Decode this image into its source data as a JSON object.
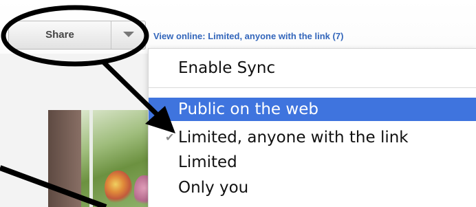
{
  "toolbar": {
    "share_label": "Share",
    "dropdown_icon": "triangle-down-icon",
    "view_online": "View online: Limited, anyone with the link (7)"
  },
  "menu": {
    "items": [
      {
        "label": "Enable Sync",
        "checked": false,
        "highlighted": false
      },
      {
        "label": "Public on the web",
        "checked": false,
        "highlighted": true
      },
      {
        "label": "Limited, anyone with the link",
        "checked": true,
        "highlighted": false
      },
      {
        "label": "Limited",
        "checked": false,
        "highlighted": false
      },
      {
        "label": "Only you",
        "checked": false,
        "highlighted": false
      }
    ],
    "check_icon": "checkmark-icon"
  },
  "colors": {
    "highlight": "#3f74de",
    "link": "#3366bb",
    "annotation": "#000000"
  }
}
